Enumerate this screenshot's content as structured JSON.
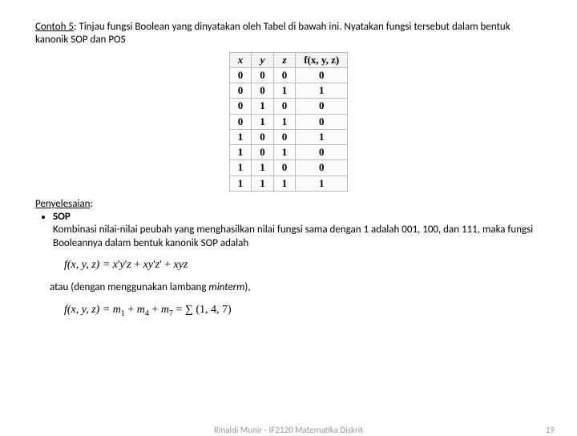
{
  "heading": {
    "label": "Contoh 5",
    "text": ": Tinjau fungsi Boolean yang dinyatakan oleh Tabel di bawah ini. Nyatakan fungsi tersebut dalam bentuk kanonik SOP dan POS"
  },
  "table": {
    "headers": {
      "x": "x",
      "y": "y",
      "z": "z",
      "f": "f(x, y, z)"
    },
    "rows": [
      {
        "x": "0",
        "y": "0",
        "z": "0",
        "f": "0"
      },
      {
        "x": "0",
        "y": "0",
        "z": "1",
        "f": "1"
      },
      {
        "x": "0",
        "y": "1",
        "z": "0",
        "f": "0"
      },
      {
        "x": "0",
        "y": "1",
        "z": "1",
        "f": "0"
      },
      {
        "x": "1",
        "y": "0",
        "z": "0",
        "f": "1"
      },
      {
        "x": "1",
        "y": "0",
        "z": "1",
        "f": "0"
      },
      {
        "x": "1",
        "y": "1",
        "z": "0",
        "f": "0"
      },
      {
        "x": "1",
        "y": "1",
        "z": "1",
        "f": "1"
      }
    ]
  },
  "solution": {
    "label": "Penyelesaian",
    "bullet": "SOP",
    "para": "Kombinasi nilai-nilai peubah yang menghasilkan nilai fungsi sama dengan 1 adalah 001, 100, dan 111, maka fungsi Booleannya dalam bentuk kanonik SOP adalah"
  },
  "eq1": {
    "lhs": "f(x, y, z) = ",
    "t1a": "x",
    "t1b": "'",
    "t1c": "y",
    "t1d": "'",
    "t1e": "z",
    "plus1": " + ",
    "t2a": "xy",
    "t2b": "'",
    "t2c": "z",
    "t2d": "'",
    "plus2": " + ",
    "t3": "xyz"
  },
  "mid": {
    "a": "atau (dengan menggunakan lambang ",
    "b": "minterm",
    "c": "),"
  },
  "eq2": {
    "lhs": "f(x, y, z) = ",
    "m": "m",
    "s1": "1",
    "p1": " + ",
    "s2": "4",
    "p2": " + ",
    "s3": "7",
    "eq": " = ",
    "sig": "∑",
    "set": " (1, 4, 7)"
  },
  "footer": {
    "center": "Rinaldi Munir - IF2120  Matematika Diskrit",
    "page": "19"
  }
}
